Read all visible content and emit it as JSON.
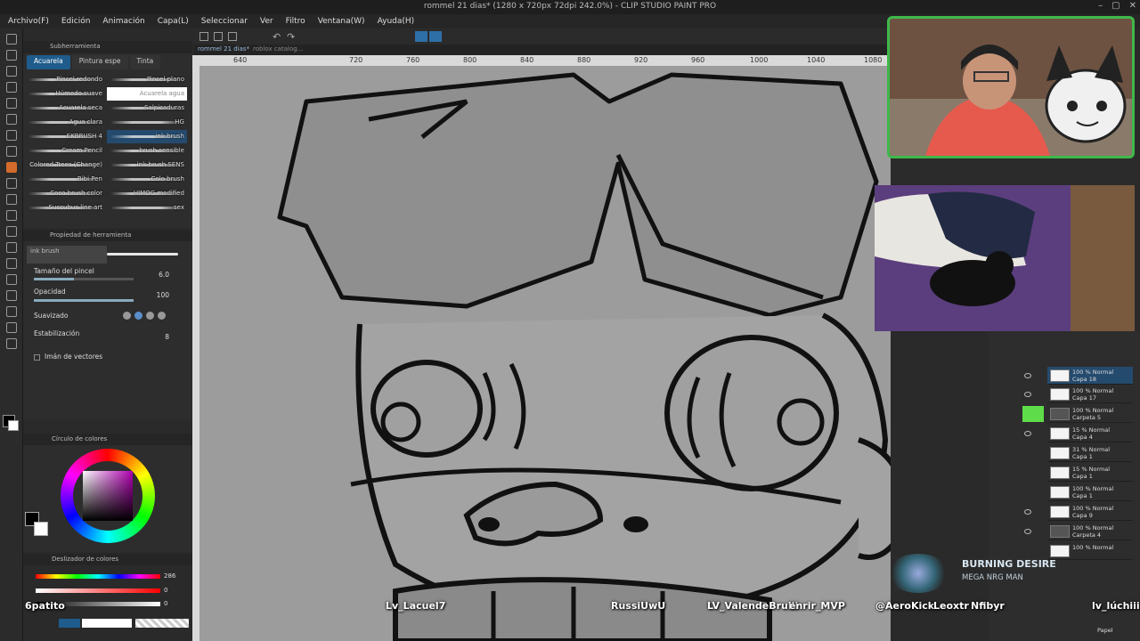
{
  "window": {
    "title": "rommel 21 dias* (1280 x 720px 72dpi 242.0%) - CLIP STUDIO PAINT PRO"
  },
  "menu": [
    "Archivo(F)",
    "Edición",
    "Animación",
    "Capa(L)",
    "Seleccionar",
    "Ver",
    "Filtro",
    "Ventana(W)",
    "Ayuda(H)"
  ],
  "subtool": {
    "panel_title": "Subherramienta",
    "tabs": [
      "Acuarela",
      "Pintura espe",
      "Tinta"
    ],
    "active_tab": "Acuarela",
    "brushes": [
      [
        "Pincel redondo",
        "Pincel plano"
      ],
      [
        "Húmedo suave",
        "Acuarela agua"
      ],
      [
        "Acuarela seca",
        "Salpicaduras"
      ],
      [
        "Agua clara",
        "HG"
      ],
      [
        "EKBRUSH 4",
        "ink brush"
      ],
      [
        "Cream Pencil",
        "brush sensible"
      ],
      [
        "Colored Trees (Change)",
        "ink brush SENS"
      ],
      [
        "Bibi Pen",
        "Colo brush"
      ],
      [
        "Coco brush color",
        "HIMOG modified"
      ],
      [
        "Succubus line art",
        "sex"
      ]
    ]
  },
  "tool_property": {
    "panel_title": "Propiedad de herramienta",
    "brush_name": "ink brush",
    "brush_size_label": "Tamaño del pincel",
    "brush_size_value": "6.0",
    "opacity_label": "Opacidad",
    "opacity_value": "100",
    "smoothing_label": "Suavizado",
    "stabilization_label": "Estabilización",
    "stabilization_value": "8",
    "vector_magnet_label": "Imán de vectores"
  },
  "color": {
    "wheel_title": "Círculo de colores",
    "slider_title": "Deslizador de colores",
    "h_value": "286",
    "s_value": "0",
    "v_value": "0"
  },
  "canvas": {
    "tabs": [
      "rommel 21 dias*",
      "roblox catalog..."
    ],
    "ruler_ticks": [
      "640",
      "720",
      "760",
      "800",
      "840",
      "880",
      "920",
      "960",
      "1000",
      "1040",
      "1080"
    ]
  },
  "layers": [
    {
      "opacity": "100 % Normal",
      "name": "Capa 18",
      "selected": true
    },
    {
      "opacity": "100 % Normal",
      "name": "Capa 17"
    },
    {
      "opacity": "100 % Normal",
      "name": "Carpeta 5"
    },
    {
      "opacity": "15 % Normal",
      "name": "Capa 4"
    },
    {
      "opacity": "31 % Normal",
      "name": "Capa 1"
    },
    {
      "opacity": "15 % Normal",
      "name": "Capa 1"
    },
    {
      "opacity": "100 % Normal",
      "name": "Capa 1"
    },
    {
      "opacity": "100 % Normal",
      "name": "Capa 9"
    },
    {
      "opacity": "100 % Normal",
      "name": "Carpeta 4"
    },
    {
      "opacity": "100 % Normal",
      "name": ""
    }
  ],
  "layer_bottom_label": "Papel",
  "music": {
    "title": "BURNING DESIRE",
    "artist": "MEGA NRG MAN"
  },
  "chat_users": [
    "6patito",
    "Lv_Lacuel7",
    "RussiUwU",
    "LV_ValendeBrulli",
    "enrir_MVP",
    "@AeroKick",
    "Leoxtr",
    "Nfibyr",
    "lv_lúchiii"
  ],
  "colors": {
    "accent_orange": "#d46b2a",
    "selection_blue": "#244b6e",
    "stream_green": "#3fb84a"
  }
}
